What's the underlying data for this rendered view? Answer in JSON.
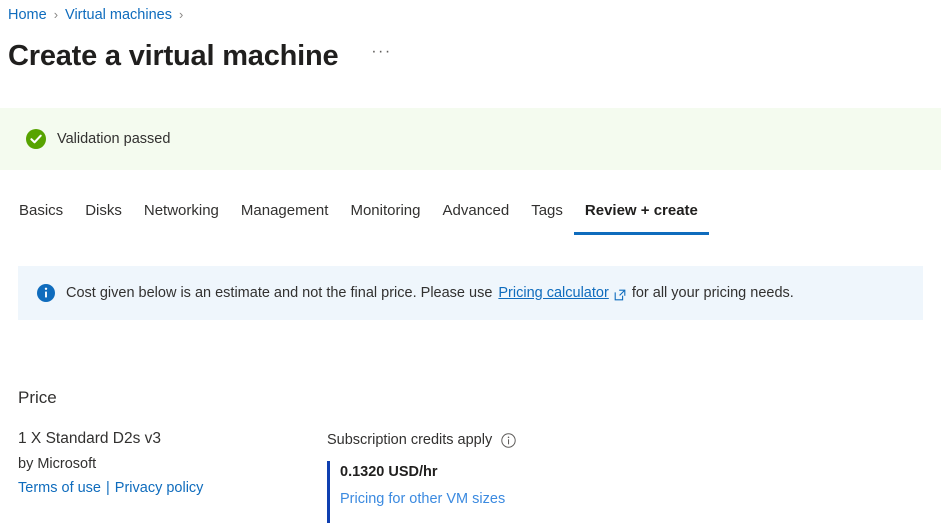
{
  "breadcrumb": {
    "items": [
      {
        "label": "Home"
      },
      {
        "label": "Virtual machines"
      }
    ],
    "separator": "›"
  },
  "header": {
    "title": "Create a virtual machine",
    "more_label": "···"
  },
  "validation": {
    "icon": "check-circle-icon",
    "message": "Validation passed",
    "color": "#57a300",
    "background": "#f4fbef"
  },
  "tabs": [
    {
      "label": "Basics",
      "active": false
    },
    {
      "label": "Disks",
      "active": false
    },
    {
      "label": "Networking",
      "active": false
    },
    {
      "label": "Management",
      "active": false
    },
    {
      "label": "Monitoring",
      "active": false
    },
    {
      "label": "Advanced",
      "active": false
    },
    {
      "label": "Tags",
      "active": false
    },
    {
      "label": "Review + create",
      "active": true
    }
  ],
  "info_banner": {
    "icon": "info-circle-filled-icon",
    "text_before": "Cost given below is an estimate and not the final price. Please use",
    "link_label": "Pricing calculator",
    "link_icon": "external-link-icon",
    "text_after": "for all your pricing needs.",
    "background": "#eff6fc",
    "accent": "#0f6cbd"
  },
  "price": {
    "heading": "Price",
    "sku": "1 X Standard D2s v3",
    "publisher": "by Microsoft",
    "terms_label": "Terms of use",
    "links_separator": "|",
    "privacy_label": "Privacy policy",
    "credits_label": "Subscription credits apply",
    "credits_info_icon": "info-circle-outline-icon",
    "amount": "0.1320 USD/hr",
    "other_sizes_label": "Pricing for other VM sizes",
    "accent_bar_color": "#0f3fb0"
  }
}
